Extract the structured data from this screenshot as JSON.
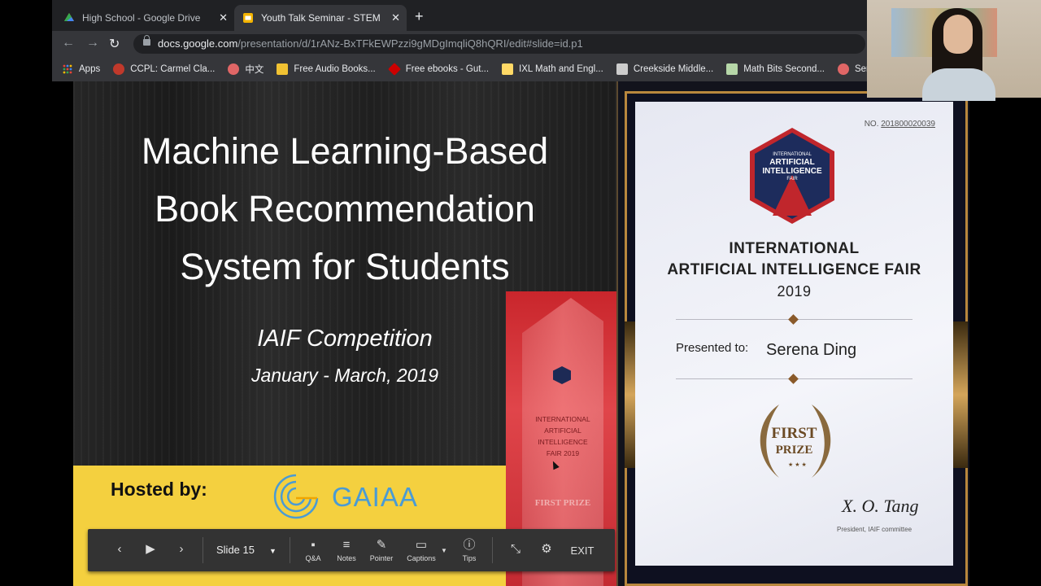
{
  "browser": {
    "tabs": [
      {
        "title": "High School - Google Drive",
        "icon": "google-drive-icon",
        "active": false
      },
      {
        "title": "Youth Talk Seminar - STEM Re",
        "icon": "google-slides-icon",
        "active": true
      }
    ],
    "url_domain": "docs.google.com",
    "url_path": "/presentation/d/1rANz-BxTFkEWPzzi9gMDgImqliQ8hQRI/edit#slide=id.p1",
    "bookmarks": [
      {
        "label": "Apps",
        "color": "#ea4335"
      },
      {
        "label": "CCPL: Carmel Cla...",
        "color": "#c0392b"
      },
      {
        "label": "中文",
        "color": "#e06666"
      },
      {
        "label": "Free Audio Books...",
        "color": "#f1c232"
      },
      {
        "label": "Free ebooks - Gut...",
        "color": "#cc0000"
      },
      {
        "label": "IXL Math and Engl...",
        "color": "#ffd966"
      },
      {
        "label": "Creekside Middle...",
        "color": "#cccccc"
      },
      {
        "label": "Math Bits Second...",
        "color": "#b6d7a8"
      },
      {
        "label": "Ser",
        "color": "#e06666"
      }
    ]
  },
  "slide": {
    "title_line1": "Machine Learning-Based",
    "title_line2": "Book Recommendation",
    "title_line3": "System for Students",
    "competition": "IAIF Competition",
    "dates": "January - March, 2019",
    "hosted_by": "Hosted by:",
    "host_name": "GAIAA",
    "trophy_text": "INTERNATIONAL ARTIFICIAL INTELLIGENCE FAIR 2019",
    "trophy_prize": "FIRST PRIZE"
  },
  "controls": {
    "slide_label": "Slide 15",
    "qa": "Q&A",
    "notes": "Notes",
    "pointer": "Pointer",
    "captions": "Captions",
    "tips": "Tips",
    "exit": "EXIT"
  },
  "certificate": {
    "number_label": "NO.",
    "number": "201800020039",
    "badge_line1": "INTERNATIONAL",
    "badge_line2": "ARTIFICIAL",
    "badge_line3": "INTELLIGENCE",
    "badge_line4": "FAIR",
    "title_line1": "INTERNATIONAL",
    "title_line2": "ARTIFICIAL INTELLIGENCE FAIR",
    "year": "2019",
    "presented_to": "Presented to:",
    "recipient": "Serena Ding",
    "prize_line1": "FIRST",
    "prize_line2": "PRIZE",
    "signature": "X. O. Tang",
    "signer_title": "President, IAIF committee"
  }
}
